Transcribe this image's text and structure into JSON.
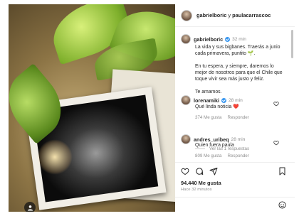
{
  "header": {
    "user1": "gabrielboric",
    "conj": " y ",
    "user2": "paulacarrascoc"
  },
  "post": {
    "username": "gabrielboric",
    "time": "32 min",
    "caption_lines": [
      "La vida y sus bigbanes. Traerás a junio cada primavera, puntito 🌱.",
      "En tu espera, y siempre, daremos lo mejor de nosotros para que el Chile que toque vivir sea más justo y feliz.",
      "Te amamos."
    ]
  },
  "comments": [
    {
      "username": "lorenamiki",
      "time": "28 min",
      "text": "Qué linda noticia ❤️",
      "likes": "374 Me gusta",
      "reply": "Responder",
      "verified": true
    },
    {
      "username": "andres_uribeq",
      "time": "28 min",
      "text": "Quien fuera paula",
      "likes": "809 Me gusta",
      "reply": "Responder",
      "verified": false
    }
  ],
  "view_replies": "Ver las 1 respuestas",
  "likes_count": "94.440 Me gusta",
  "post_time": "Hace 32 minutos",
  "colors": {
    "verified": "#3897f0",
    "heart": "#ed4956",
    "muted": "#8e8e8e"
  }
}
